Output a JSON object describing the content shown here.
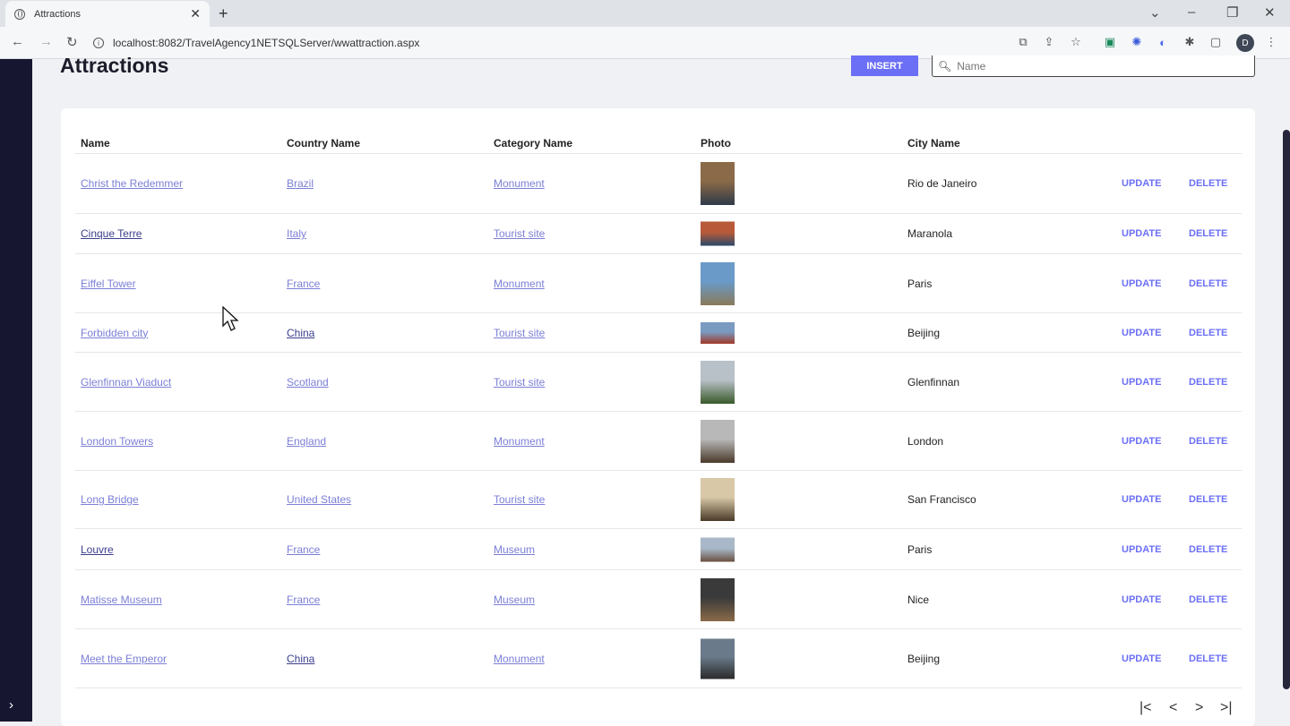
{
  "browser": {
    "tab_title": "Attractions",
    "url": "localhost:8082/TravelAgency1NETSQLServer/wwattraction.aspx",
    "avatar_letter": "D"
  },
  "page": {
    "title": "Attractions",
    "insert_label": "INSERT",
    "search_placeholder": "Name"
  },
  "grid": {
    "headers": [
      "Name",
      "Country Name",
      "Category Name",
      "Photo",
      "City Name"
    ],
    "update_label": "UPDATE",
    "delete_label": "DELETE",
    "rows": [
      {
        "name": "Christ the Redemmer",
        "country": "Brazil",
        "category": "Monument",
        "city": "Rio de Janeiro",
        "photo_colors": [
          "#8a6a48",
          "#2e3a48"
        ]
      },
      {
        "name": "Cinque Terre",
        "country": "Italy",
        "category": "Tourist site",
        "city": "Maranola",
        "photo_colors": [
          "#b85a3a",
          "#2a4a6a"
        ]
      },
      {
        "name": "Eiffel Tower",
        "country": "France",
        "category": "Monument",
        "city": "Paris",
        "photo_colors": [
          "#6a9ac8",
          "#8a7a5a"
        ]
      },
      {
        "name": "Forbidden city",
        "country": "China",
        "category": "Tourist site",
        "city": "Beijing",
        "photo_colors": [
          "#7a9ac0",
          "#a03828"
        ]
      },
      {
        "name": "Glenfinnan Viaduct",
        "country": "Scotland",
        "category": "Tourist site",
        "city": "Glenfinnan",
        "photo_colors": [
          "#b8c0c8",
          "#3a5a2a"
        ]
      },
      {
        "name": "London Towers",
        "country": "England",
        "category": "Monument",
        "city": "London",
        "photo_colors": [
          "#b8b8b8",
          "#4a3a2a"
        ]
      },
      {
        "name": "Long Bridge",
        "country": "United States",
        "category": "Tourist site",
        "city": "San Francisco",
        "photo_colors": [
          "#d8c8a8",
          "#4a3a28"
        ]
      },
      {
        "name": "Louvre",
        "country": "France",
        "category": "Museum",
        "city": "Paris",
        "photo_colors": [
          "#a8b8c8",
          "#6a5040"
        ]
      },
      {
        "name": "Matisse Museum",
        "country": "France",
        "category": "Museum",
        "city": "Nice",
        "photo_colors": [
          "#3a3a3a",
          "#8a6a48"
        ]
      },
      {
        "name": "Meet the Emperor",
        "country": "China",
        "category": "Monument",
        "city": "Beijing",
        "photo_colors": [
          "#6a7a8a",
          "#2a2a2a"
        ]
      }
    ]
  },
  "pager": {
    "first": "|<",
    "prev": "<",
    "next": ">",
    "last": ">|"
  }
}
